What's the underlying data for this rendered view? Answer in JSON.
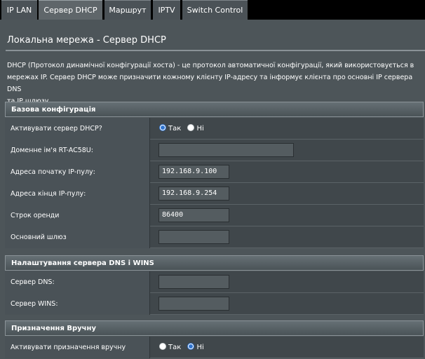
{
  "tabs": [
    {
      "label": "IP LAN",
      "active": false
    },
    {
      "label": "Сервер DHCP",
      "active": true
    },
    {
      "label": "Маршрут",
      "active": false
    },
    {
      "label": "IPTV",
      "active": false
    },
    {
      "label": "Switch Control",
      "active": false
    }
  ],
  "page": {
    "title": "Локальна мережа - Сервер DHCP",
    "description_lines": [
      "DHCP (Протокол динамічної конфігурації хоста) - це протокол автоматичної конфігурації, який використовується в",
      "мережах IP. Сервер DHCP може призначити кожному клієнту IP-адресу та інформує клієнта про основні IP сервера DNS",
      "та IP шлюзу."
    ]
  },
  "basic": {
    "header": "Базова конфігурація",
    "enable_dhcp": {
      "label": "Активувати сервер DHCP?",
      "yes": "Так",
      "no": "Ні",
      "selected": "yes"
    },
    "domain_name": {
      "label": "Доменне ім'я RT-AC58U:",
      "value": ""
    },
    "pool_start": {
      "label": "Адреса початку IP-пулу:",
      "value": "192.168.9.100"
    },
    "pool_end": {
      "label": "Адреса кінця IP-пулу:",
      "value": "192.168.9.254"
    },
    "lease_time": {
      "label": "Строк оренди",
      "value": "86400"
    },
    "gateway": {
      "label": "Основний шлюз",
      "value": ""
    }
  },
  "dns_wins": {
    "header": "Налаштування сервера DNS і WINS",
    "dns": {
      "label": "Сервер DNS:",
      "value": ""
    },
    "wins": {
      "label": "Сервер WINS:",
      "value": ""
    }
  },
  "manual": {
    "header": "Призначення Вручну",
    "enable_manual": {
      "label": "Активувати призначення вручну",
      "yes": "Так",
      "no": "Ні",
      "selected": "no"
    }
  },
  "colors": {
    "panel": "#4d5559",
    "radio_selected": "#2f74d0"
  }
}
